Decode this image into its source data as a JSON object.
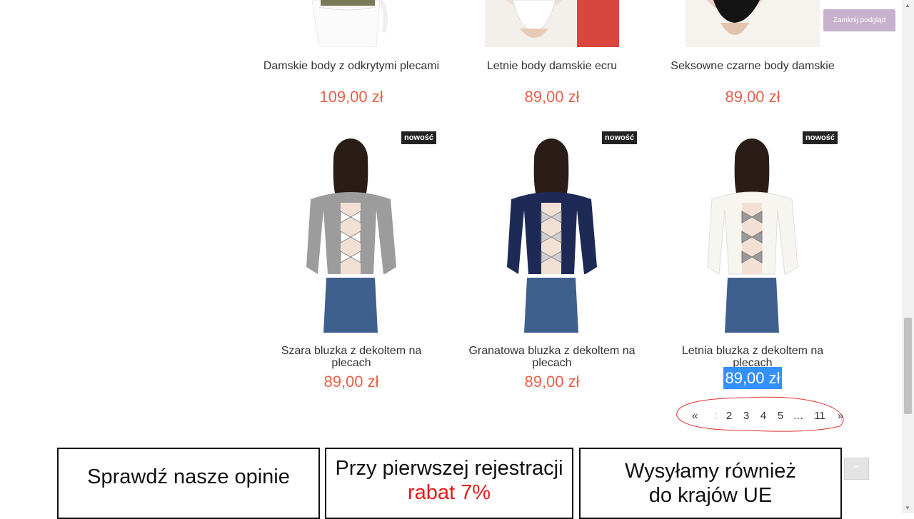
{
  "close_preview_label": "Zamknij podgląd",
  "products": [
    {
      "name": "Damskie body z odkrytymi plecami",
      "price": "109,00 zł"
    },
    {
      "name": "Letnie body damskie ecru",
      "price": "89,00 zł"
    },
    {
      "name": "Seksowne czarne body damskie",
      "price": "89,00 zł"
    },
    {
      "name": "Szara bluzka z dekoltem na plecach",
      "price": "89,00 zł",
      "badge": "nowość"
    },
    {
      "name": "Granatowa bluzka z dekoltem na plecach",
      "price": "89,00 zł",
      "badge": "nowość"
    },
    {
      "name": "Letnia bluzka z dekoltem na plecach",
      "price": "89,00 zł",
      "badge": "nowość"
    }
  ],
  "pagination": {
    "prev": "«",
    "pages": [
      "1",
      "2",
      "3",
      "4",
      "5",
      "…",
      "11"
    ],
    "next": "»",
    "current": "1"
  },
  "banners": {
    "opinions": "Sprawdź nasze opinie",
    "registration_line1": "Przy pierwszej rejestracji",
    "registration_line2": "rabat 7%",
    "shipping_line1": "Wysyłamy również",
    "shipping_line2": "do krajów UE"
  },
  "colors": {
    "price": "#e8604c",
    "badge_bg": "#222222",
    "close_btn_bg": "#c8b1cc",
    "selection": "#3390ff",
    "annotation": "#e23232",
    "banner_accent": "#e51b1b"
  },
  "icons": {
    "back_to_top": "chevron-up-icon"
  }
}
